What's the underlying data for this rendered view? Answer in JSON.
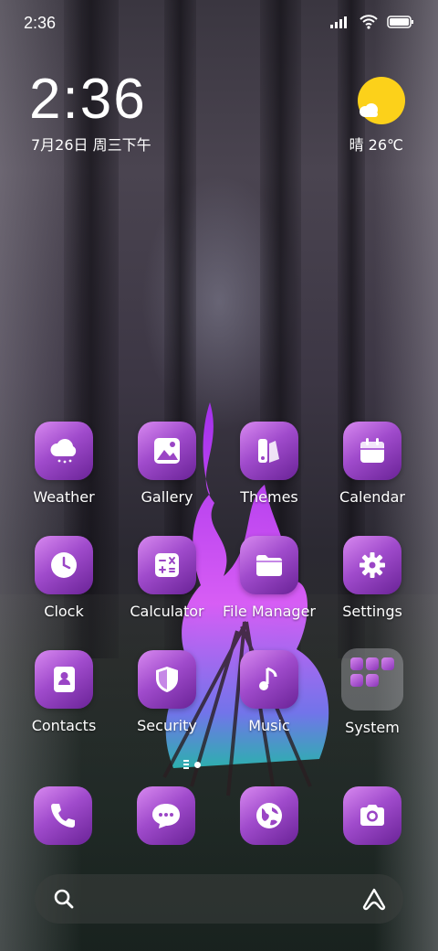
{
  "status_bar": {
    "time": "2:36"
  },
  "clock_widget": {
    "time": "2:36",
    "date": "7月26日 周三下午"
  },
  "weather_widget": {
    "condition_temp": "晴 26℃",
    "icon": "sunny-cloud-icon"
  },
  "apps": [
    {
      "label": "Weather",
      "icon": "weather-icon"
    },
    {
      "label": "Gallery",
      "icon": "gallery-icon"
    },
    {
      "label": "Themes",
      "icon": "themes-icon"
    },
    {
      "label": "Calendar",
      "icon": "calendar-icon"
    },
    {
      "label": "Clock",
      "icon": "clock-icon"
    },
    {
      "label": "Calculator",
      "icon": "calculator-icon"
    },
    {
      "label": "File Manager",
      "icon": "folder-icon"
    },
    {
      "label": "Settings",
      "icon": "gear-icon"
    },
    {
      "label": "Contacts",
      "icon": "contacts-icon"
    },
    {
      "label": "Security",
      "icon": "shield-icon"
    },
    {
      "label": "Music",
      "icon": "music-icon"
    },
    {
      "label": "System",
      "icon": "folder-group-icon"
    }
  ],
  "dock": [
    {
      "icon": "phone-icon"
    },
    {
      "icon": "messages-icon"
    },
    {
      "icon": "browser-icon"
    },
    {
      "icon": "camera-icon"
    }
  ],
  "colors": {
    "icon_gradient_start": "#d889f0",
    "icon_gradient_end": "#6a2397",
    "sun": "#fcd11a"
  }
}
